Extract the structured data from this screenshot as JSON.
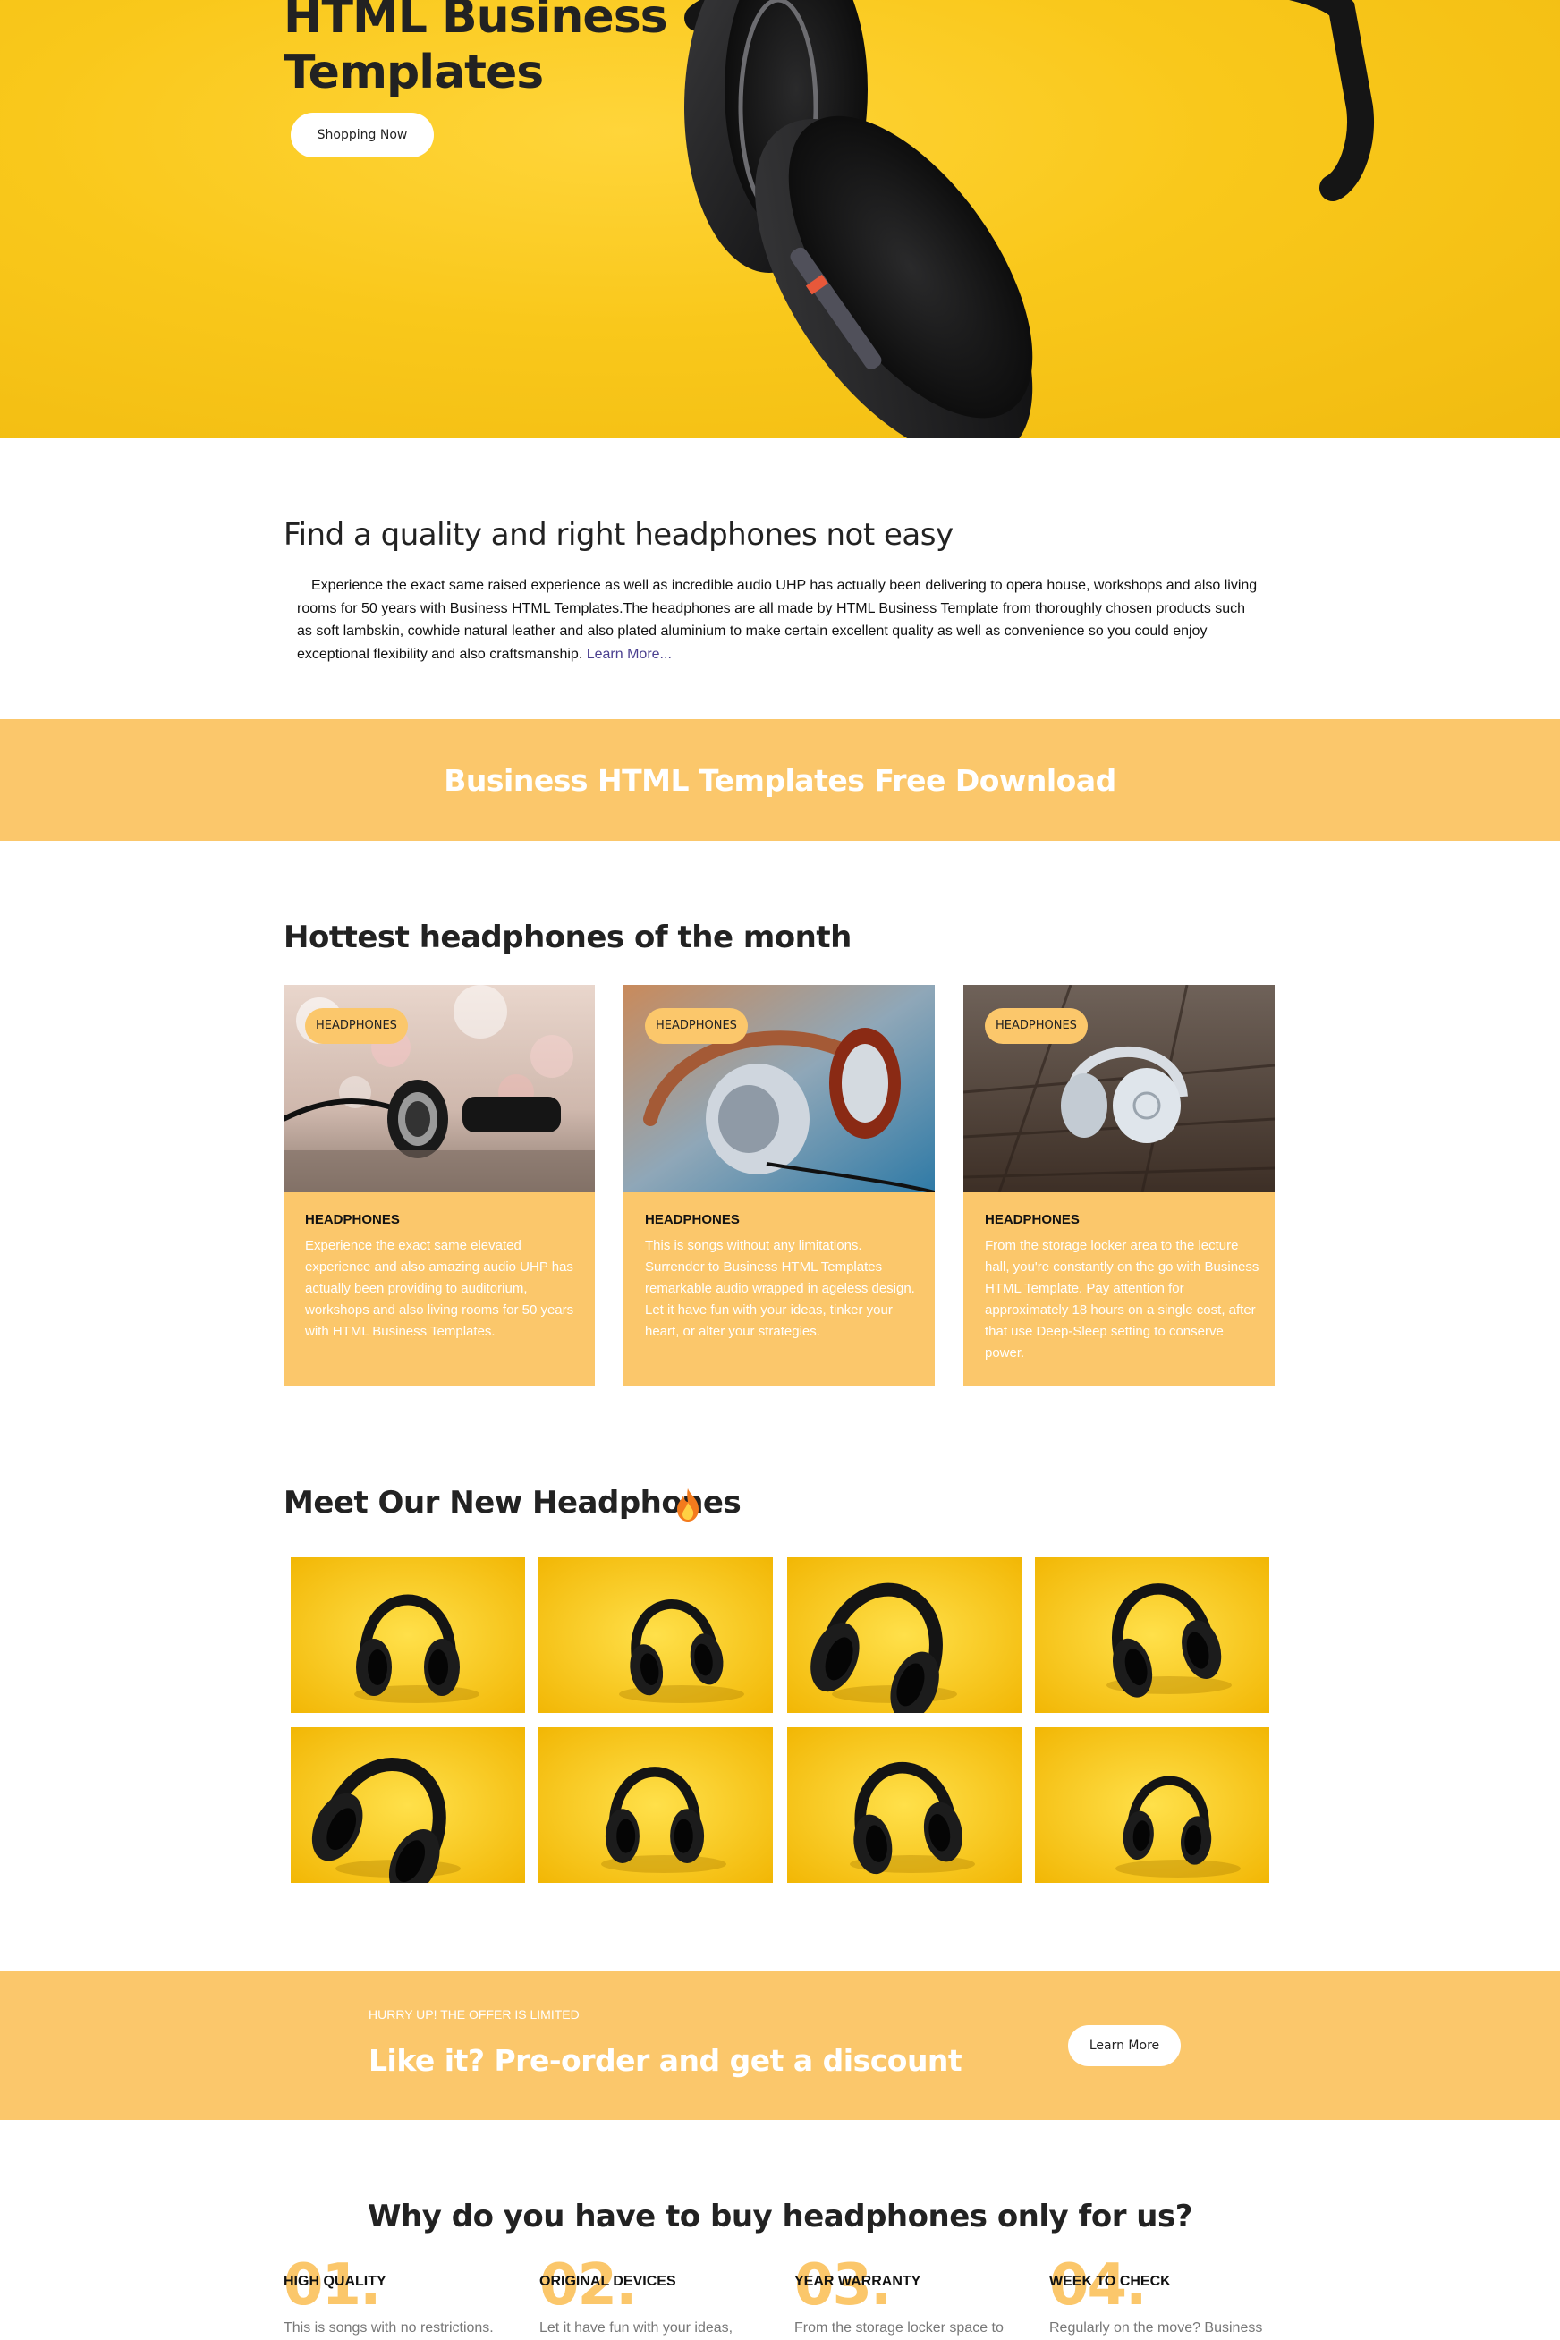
{
  "hero": {
    "title": "HTML Business Templates",
    "button_label": "Shopping Now"
  },
  "about": {
    "heading": "Find a quality and right headphones not easy",
    "paragraph": "Experience the exact same raised experience as well as incredible audio UHP has actually been delivering to opera house, workshops and also living rooms for 50 years with Business HTML Templates.The headphones are all made by HTML Business Template from thoroughly chosen products such as soft lambskin, cowhide natural leather and also plated aluminium to make certain excellent quality as well as convenience so you could enjoy exceptional flexibility and also craftsmanship.",
    "link_label": "Learn More..."
  },
  "banner": {
    "text": "Business HTML Templates Free Download"
  },
  "hottest": {
    "heading": "Hottest headphones of the month",
    "cards": [
      {
        "tag": "HEADPHONES",
        "title": "HEADPHONES",
        "text": "Experience the exact same elevated experience and also amazing audio UHP has actually been providing to auditorium, workshops and also living rooms for 50 years with HTML Business Templates."
      },
      {
        "tag": "HEADPHONES",
        "title": "HEADPHONES",
        "text": "This is songs without any limitations. Surrender to Business HTML Templates remarkable audio wrapped in ageless design. Let it have fun with your ideas, tinker your heart, or alter your strategies."
      },
      {
        "tag": "HEADPHONES",
        "title": "HEADPHONES",
        "text": "From the storage locker area to the lecture hall, you're constantly on the go with Business HTML Template. Pay attention for approximately 18 hours on a single cost, after that use Deep-Sleep setting to conserve power."
      }
    ]
  },
  "meet": {
    "heading": "Meet Our New Headphones",
    "icon": "fire-emoji-icon",
    "gallery": [
      "headphone-photo-1",
      "headphone-photo-2",
      "headphone-photo-3",
      "headphone-photo-4",
      "headphone-photo-5",
      "headphone-photo-6",
      "headphone-photo-7",
      "headphone-photo-8"
    ]
  },
  "offer": {
    "kicker": "HURRY UP! THE OFFER IS LIMITED",
    "title": "Like it? Pre-order and get a discount",
    "button_label": "Learn More"
  },
  "why": {
    "heading": "Why do you have to buy headphones only for us?",
    "features": [
      {
        "number": "01.",
        "title": "HIGH QUALITY",
        "text": "This is songs with no restrictions."
      },
      {
        "number": "02.",
        "title": "ORIGINAL DEVICES",
        "text": "Let it have fun with your ideas,"
      },
      {
        "number": "03.",
        "title": "YEAR WARRANTY",
        "text": "From the storage locker space to"
      },
      {
        "number": "04.",
        "title": "WEEK TO CHECK",
        "text": "Regularly on the move? Business"
      }
    ]
  },
  "colors": {
    "accent": "#fbc76b",
    "hero_yellow": "#f9c81b",
    "text_dark": "#222222",
    "link": "#4a3f8f"
  }
}
